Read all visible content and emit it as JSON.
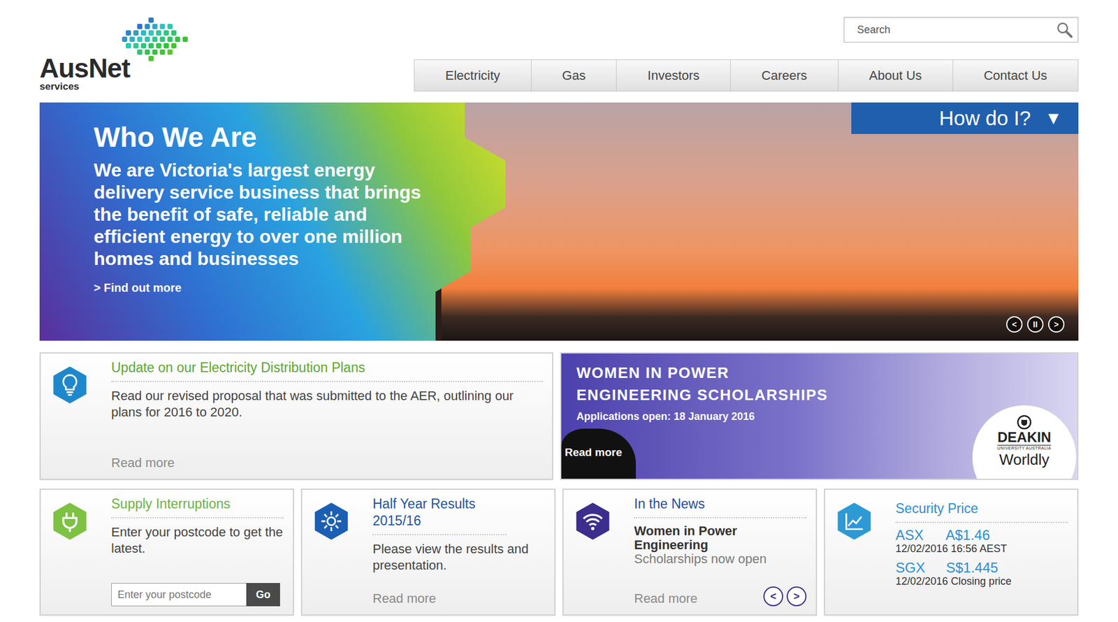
{
  "logo": {
    "name": "AusNet",
    "tagline": "services"
  },
  "search": {
    "placeholder": "Search"
  },
  "nav": [
    {
      "label": "Electricity",
      "selected": false
    },
    {
      "label": "Gas",
      "selected": false
    },
    {
      "label": "Investors",
      "selected": false
    },
    {
      "label": "Careers",
      "selected": false
    },
    {
      "label": "About Us",
      "selected": false
    },
    {
      "label": "Contact Us",
      "selected": false
    }
  ],
  "hero": {
    "title": "Who We Are",
    "body": "We are Victoria's largest energy delivery service business that brings the benefit of safe, reliable and efficient energy to over one million homes and businesses",
    "link": "> Find out more",
    "menu": {
      "label": "How do I?",
      "icon": "▼"
    },
    "controls": [
      "<",
      "II",
      ">"
    ]
  },
  "update_card": {
    "title": "Update on our Electricity Distribution Plans",
    "body": "Read our revised proposal that was submitted to the AER, outlining our plans for 2016 to 2020.",
    "link": "Read more",
    "color": "#1e88cc",
    "title_color": "#5aa832"
  },
  "banner": {
    "title_lines": [
      "WOMEN IN POWER",
      "ENGINEERING SCHOLARSHIPS"
    ],
    "subtitle": "Applications open: 18 January 2016",
    "link": "Read more",
    "partner": {
      "name": "DEAKIN",
      "sub": "UNIVERSITY AUSTRALIA",
      "tagline": "Worldly"
    }
  },
  "tiles": [
    {
      "kind": "postcode",
      "title": "Supply Interruptions",
      "body": "Enter your postcode to get the latest.",
      "placeholder": "Enter your postcode",
      "button": "Go",
      "color": "#7dc242",
      "title_color": "#6cb33f"
    },
    {
      "kind": "results",
      "title": "Half Year Results 2015/16",
      "body": "Please view the results and presentation.",
      "link": "Read more",
      "color": "#1a5fb4",
      "title_color": "#1d55a5"
    },
    {
      "kind": "news",
      "title": "In the News",
      "headline": "Women in Power Engineering",
      "body": "Scholarships now open",
      "link": "Read more",
      "prev": "<",
      "next": ">",
      "color": "#3b2e8c",
      "title_color": "#264e9b"
    },
    {
      "kind": "price",
      "title": "Security Price",
      "quotes": [
        {
          "exchange": "ASX",
          "price": "A$1.46",
          "note": "12/02/2016 16:56 AEST"
        },
        {
          "exchange": "SGX",
          "price": "S$1.445",
          "note": "12/02/2016 Closing price"
        }
      ],
      "color": "#2d9ad6",
      "title_color": "#2b8fd6"
    }
  ]
}
